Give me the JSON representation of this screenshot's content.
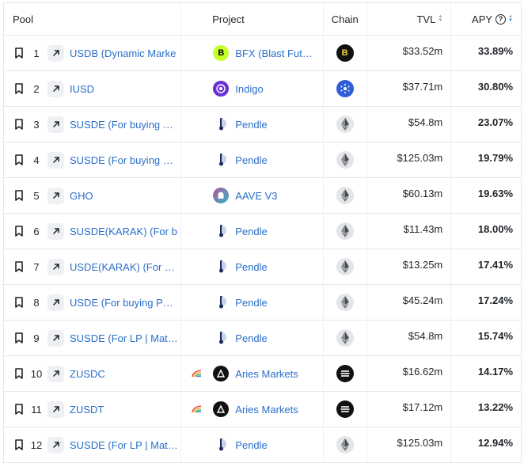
{
  "header": {
    "pool": "Pool",
    "project": "Project",
    "chain": "Chain",
    "tvl": "TVL",
    "apy": "APY",
    "help": "?"
  },
  "rows": [
    {
      "rank": "1",
      "pool": "USDB (Dynamic Marke",
      "project": "BFX (Blast Fut…",
      "project_logo": "bfx-logo",
      "chain_icon": "blast-chain-icon",
      "tvl": "$33.52m",
      "apy": "33.89%"
    },
    {
      "rank": "2",
      "pool": "IUSD",
      "project": "Indigo",
      "project_logo": "indigo-logo",
      "chain_icon": "cardano-chain-icon",
      "tvl": "$37.71m",
      "apy": "30.80%"
    },
    {
      "rank": "3",
      "pool": "SUSDE (For buying P…",
      "project": "Pendle",
      "project_logo": "pendle-logo",
      "chain_icon": "ethereum-chain-icon",
      "tvl": "$54.8m",
      "apy": "23.07%"
    },
    {
      "rank": "4",
      "pool": "SUSDE (For buying P…",
      "project": "Pendle",
      "project_logo": "pendle-logo",
      "chain_icon": "ethereum-chain-icon",
      "tvl": "$125.03m",
      "apy": "19.79%"
    },
    {
      "rank": "5",
      "pool": "GHO",
      "project": "AAVE V3",
      "project_logo": "aave-logo",
      "chain_icon": "ethereum-chain-icon",
      "tvl": "$60.13m",
      "apy": "19.63%"
    },
    {
      "rank": "6",
      "pool": "SUSDE(KARAK) (For b",
      "project": "Pendle",
      "project_logo": "pendle-logo",
      "chain_icon": "ethereum-chain-icon",
      "tvl": "$11.43m",
      "apy": "18.00%"
    },
    {
      "rank": "7",
      "pool": "USDE(KARAK) (For bu…",
      "project": "Pendle",
      "project_logo": "pendle-logo",
      "chain_icon": "ethereum-chain-icon",
      "tvl": "$13.25m",
      "apy": "17.41%"
    },
    {
      "rank": "8",
      "pool": "USDE (For buying PT…",
      "project": "Pendle",
      "project_logo": "pendle-logo",
      "chain_icon": "ethereum-chain-icon",
      "tvl": "$45.24m",
      "apy": "17.24%"
    },
    {
      "rank": "9",
      "pool": "SUSDE (For LP | Mat…",
      "project": "Pendle",
      "project_logo": "pendle-logo",
      "chain_icon": "ethereum-chain-icon",
      "tvl": "$54.8m",
      "apy": "15.74%"
    },
    {
      "rank": "10",
      "pool": "ZUSDC",
      "project": "Aries Markets",
      "project_logo": "aries-logo",
      "pre_icon": "rainbow-icon",
      "chain_icon": "aptos-chain-icon",
      "tvl": "$16.62m",
      "apy": "14.17%"
    },
    {
      "rank": "11",
      "pool": "ZUSDT",
      "project": "Aries Markets",
      "project_logo": "aries-logo",
      "pre_icon": "rainbow-icon",
      "chain_icon": "aptos-chain-icon",
      "tvl": "$17.12m",
      "apy": "13.22%"
    },
    {
      "rank": "12",
      "pool": "SUSDE (For LP | Mat…",
      "project": "Pendle",
      "project_logo": "pendle-logo",
      "chain_icon": "ethereum-chain-icon",
      "tvl": "$125.03m",
      "apy": "12.94%"
    }
  ],
  "colors": {
    "link": "#2a6fc9",
    "sort_active": "#3b82f6",
    "border": "#e5e7eb"
  }
}
